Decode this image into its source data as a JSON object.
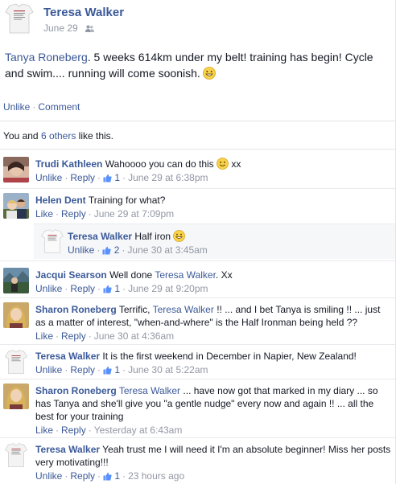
{
  "post": {
    "author": "Teresa Walker",
    "date": "June 29",
    "tagged": "Tanya Roneberg",
    "text": ". 5 weeks 614km under my belt! training has begin! Cycle and swim.... running will come soonish.",
    "actions": {
      "unlike": "Unlike",
      "comment": "Comment"
    },
    "likes": {
      "prefix": "You and ",
      "others": "6 others",
      "suffix": " like this."
    }
  },
  "comments": [
    {
      "name": "Trudi Kathleen",
      "text": "Wahoooo you can do this",
      "after": " xx",
      "emoji": "smile-emoji",
      "meta": {
        "a1": "Unlike",
        "a2": "Reply",
        "likes": "1",
        "time": "June 29 at 6:38pm"
      }
    },
    {
      "name": "Helen Dent",
      "text": "Training for what?",
      "meta": {
        "a1": "Like",
        "a2": "Reply",
        "time": "June 29 at 7:09pm"
      }
    },
    {
      "name": "Teresa Walker",
      "text": "Half iron",
      "emoji": "grin-emoji",
      "meta": {
        "a1": "Unlike",
        "a2": "Reply",
        "likes": "2",
        "time": "June 30 at 3:45am"
      }
    },
    {
      "name": "Jacqui Searson",
      "text": "Well done ",
      "mention": "Teresa Walker",
      "after": ". Xx",
      "meta": {
        "a1": "Unlike",
        "a2": "Reply",
        "likes": "1",
        "time": "June 29 at 9:20pm"
      }
    },
    {
      "name": "Sharon Roneberg",
      "text": "Terrific, ",
      "mention": "Teresa Walker",
      "after": " !! ... and I bet Tanya is smiling !! ... just as a matter of interest, \"when-and-where\" is the Half Ironman being held ??",
      "meta": {
        "a1": "Like",
        "a2": "Reply",
        "time": "June 30 at 4:36am"
      }
    },
    {
      "name": "Teresa Walker",
      "text": "It is the first weekend in December in Napier, New Zealand!",
      "meta": {
        "a1": "Unlike",
        "a2": "Reply",
        "likes": "1",
        "time": "June 30 at 5:22am"
      }
    },
    {
      "name": "Sharon Roneberg",
      "mention": "Teresa Walker",
      "after": " ... have now got that marked in my diary ... so has Tanya and she'll give you \"a gentle nudge\" every now and again !! ... all the best for your training",
      "meta": {
        "a1": "Like",
        "a2": "Reply",
        "time": "Yesterday at 6:43am"
      }
    },
    {
      "name": "Teresa Walker",
      "text": "Yeah trust me I will need it I'm an absolute beginner! Miss her posts very motivating!!!",
      "meta": {
        "a1": "Unlike",
        "a2": "Reply",
        "likes": "1",
        "time": "23 hours ago"
      }
    }
  ],
  "colors": {
    "link": "#3b5998",
    "meta": "#9197a3",
    "reply_bg": "#f6f7f9"
  },
  "icons": [
    "friends-icon",
    "thumbs-up-icon",
    "smile-emoji",
    "grin-emoji"
  ]
}
